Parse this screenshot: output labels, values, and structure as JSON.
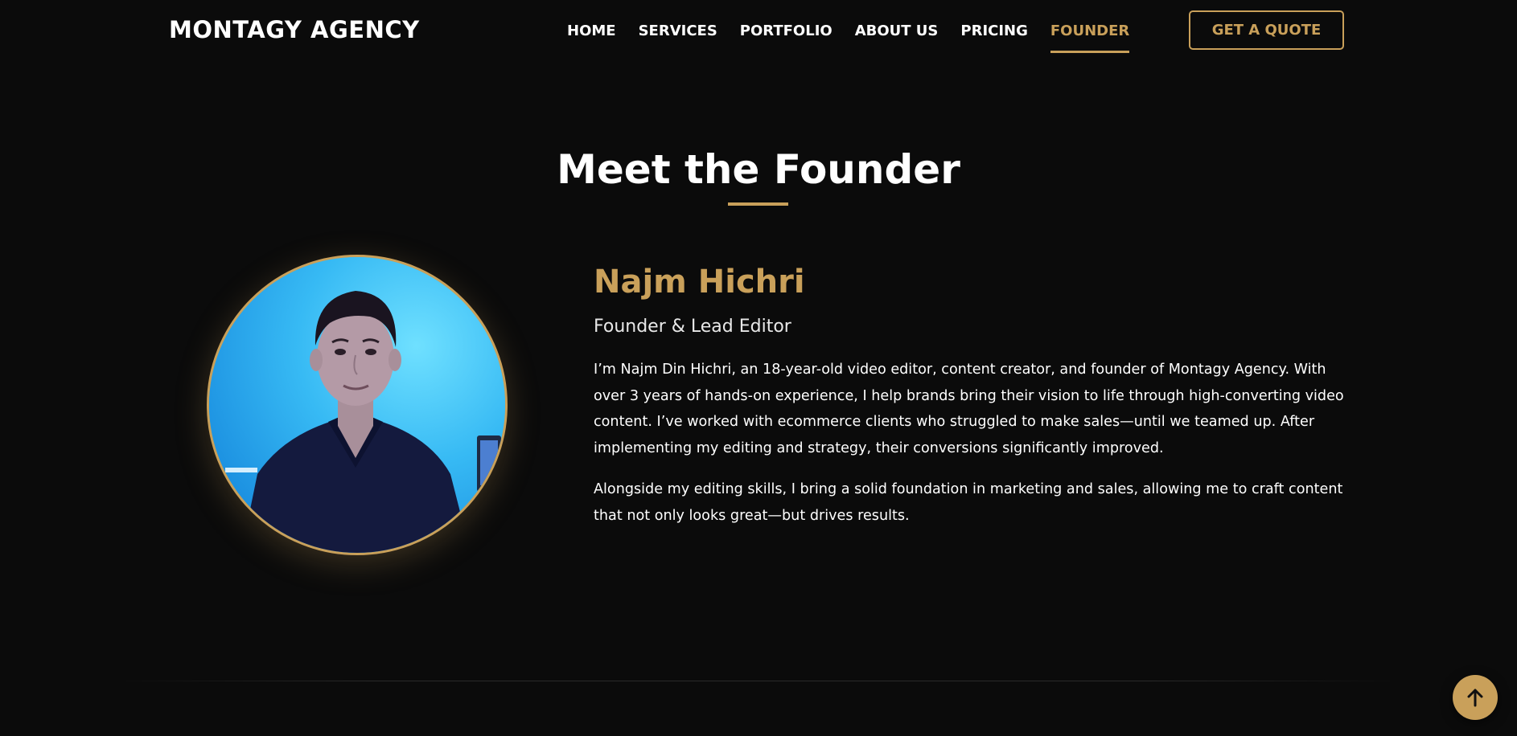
{
  "header": {
    "logo": "MONTAGY AGENCY",
    "nav": [
      {
        "label": "HOME",
        "active": false
      },
      {
        "label": "SERVICES",
        "active": false
      },
      {
        "label": "PORTFOLIO",
        "active": false
      },
      {
        "label": "ABOUT US",
        "active": false
      },
      {
        "label": "PRICING",
        "active": false
      },
      {
        "label": "FOUNDER",
        "active": true
      }
    ],
    "cta_label": "GET A QUOTE"
  },
  "founder": {
    "section_title": "Meet the Founder",
    "name": "Najm Hichri",
    "role": "Founder & Lead Editor",
    "paragraphs": [
      "I’m Najm Din Hichri, an 18-year-old video editor, content creator, and founder of Montagy Agency. With over 3 years of hands-on experience, I help brands bring their vision to life through high-converting video content. I’ve worked with ecommerce clients who struggled to make sales—until we teamed up. After implementing my editing and strategy, their conversions significantly improved.",
      "Alongside my editing skills, I bring a solid foundation in marketing and sales, allowing me to craft content that not only looks great—but drives results."
    ]
  },
  "icons": {
    "scroll_top": "arrow-up-icon"
  },
  "colors": {
    "background": "#0b0b0b",
    "accent": "#c9a05a",
    "text": "#ffffff"
  }
}
